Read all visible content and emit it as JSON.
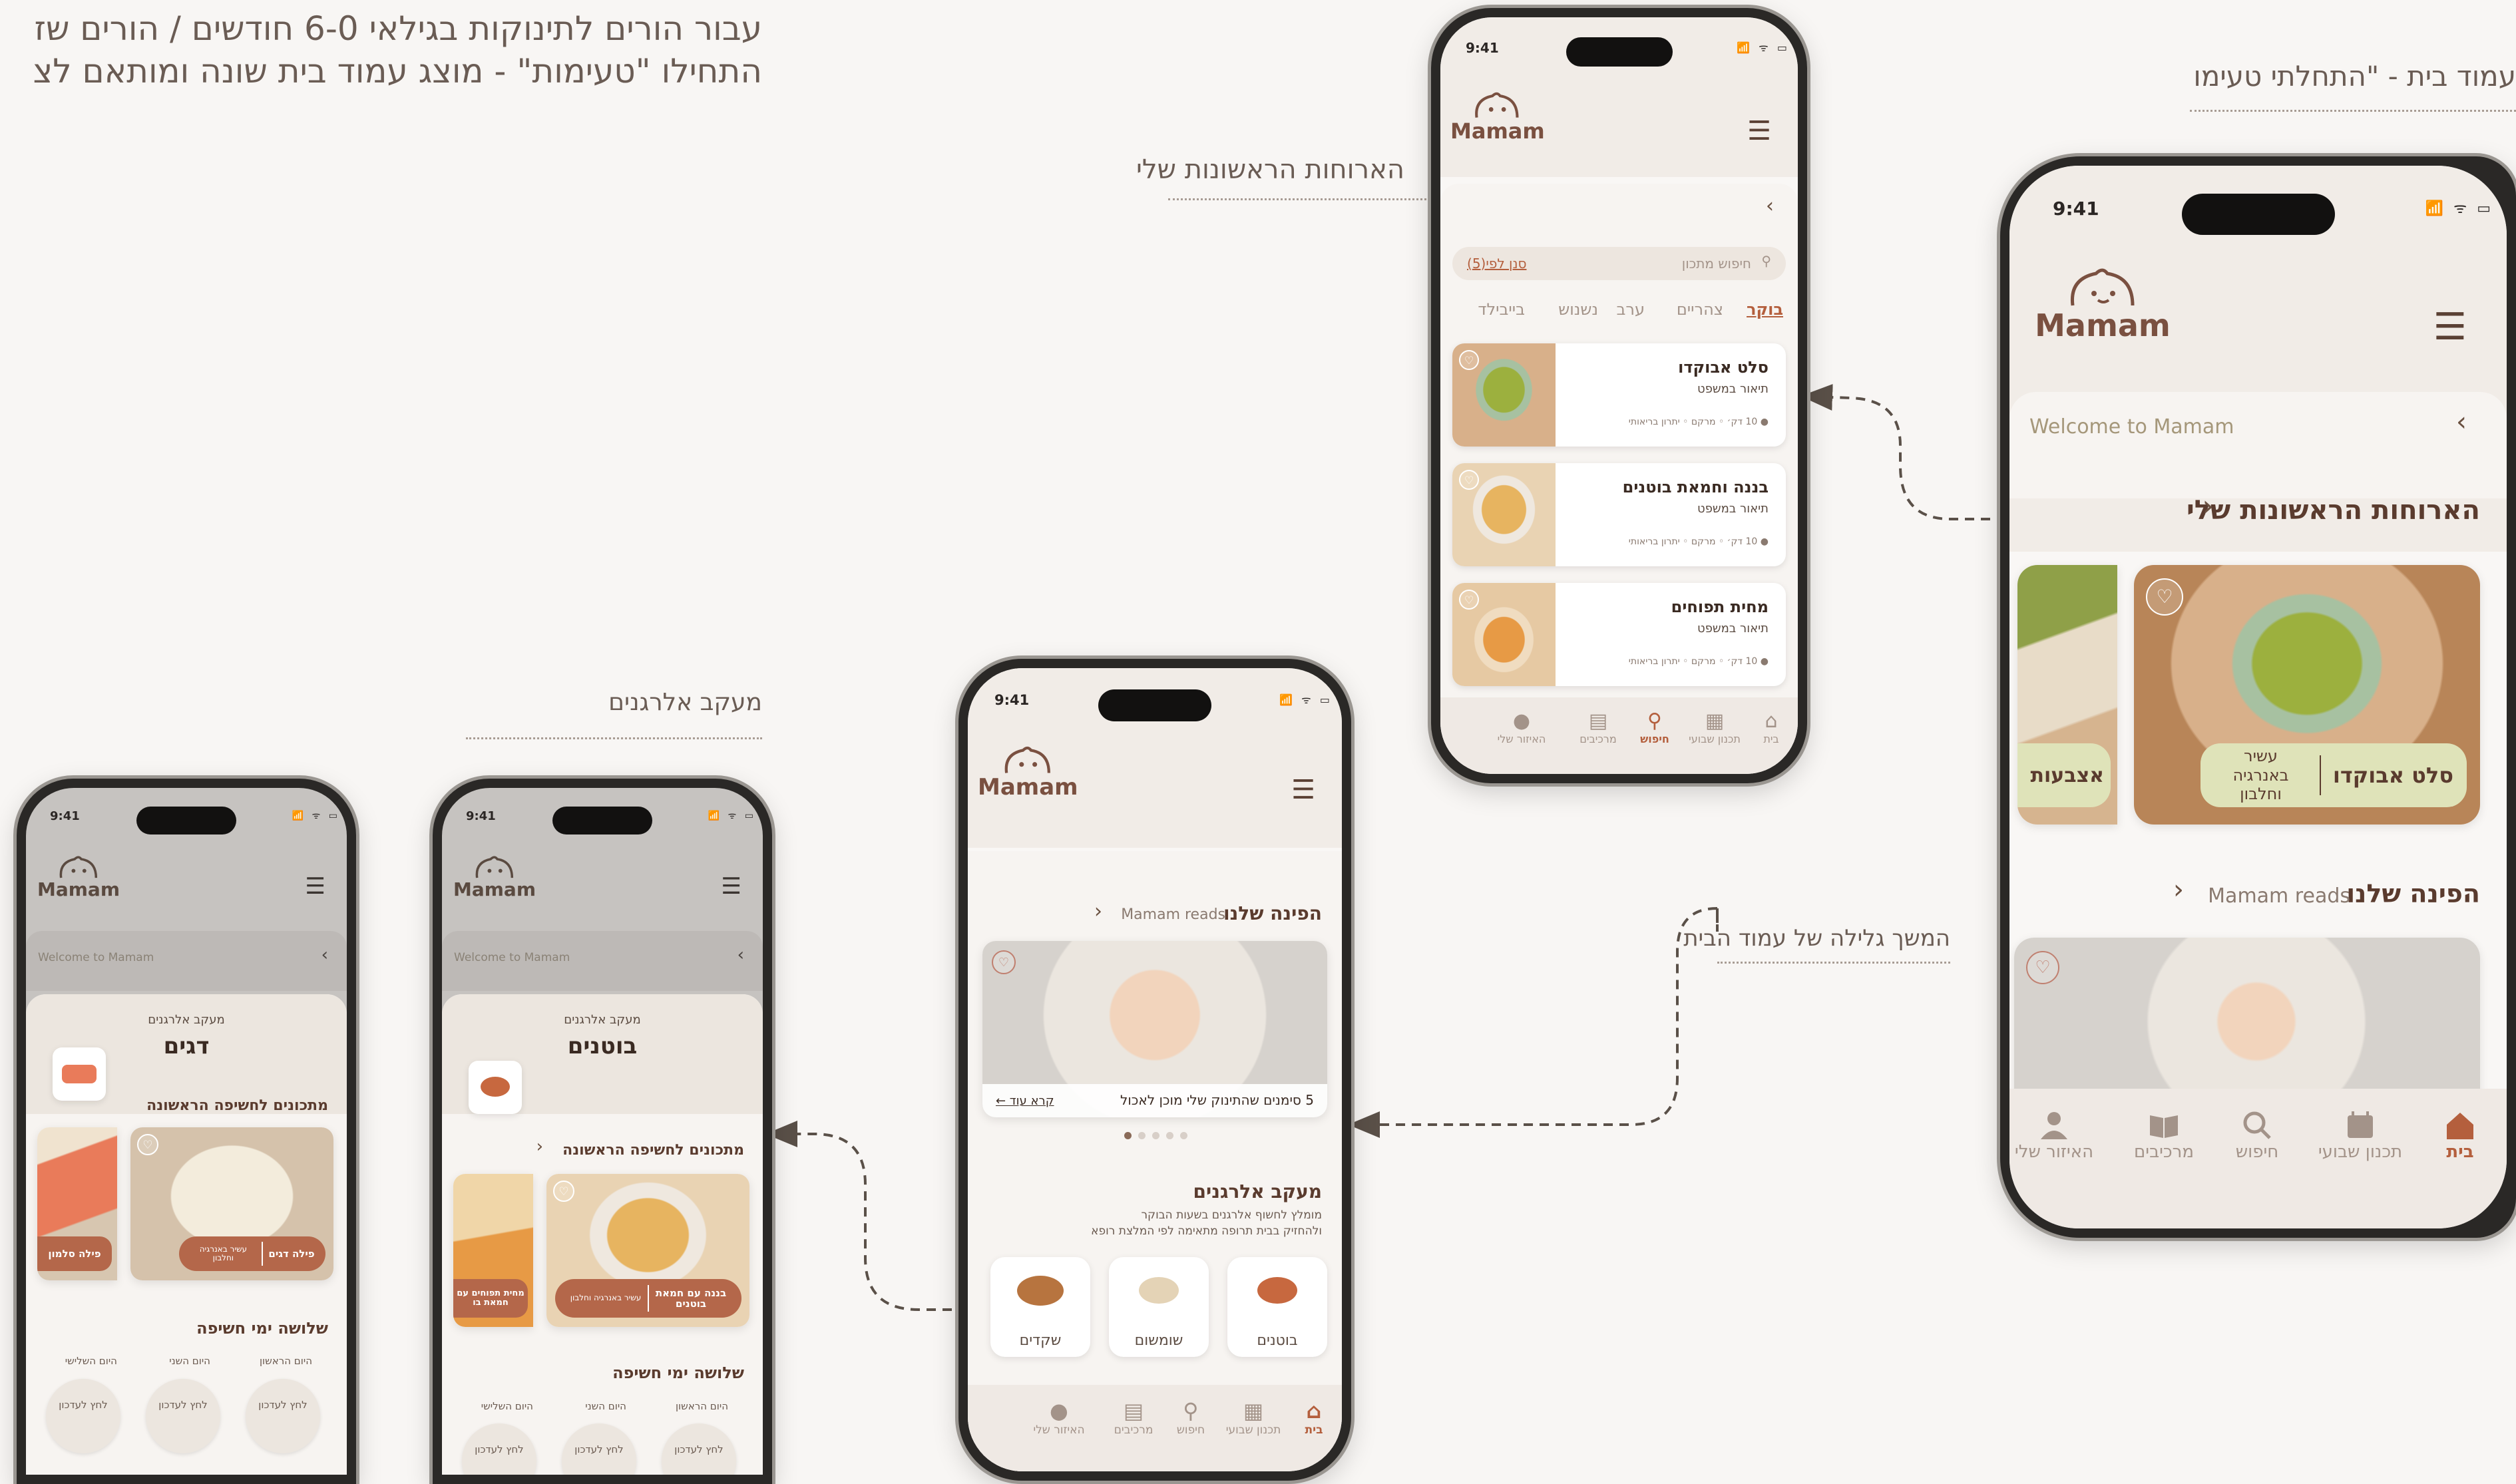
{
  "annotations": {
    "intro_line1": "עבור הורים לתינוקות בגילאי 6-0 חודשים / הורים שז",
    "intro_line2": "התחילו \"טעימות\" - מוצג עמוד בית שונה ומותאם לצ",
    "home_title": "עמוד בית - \"התחלתי טעימות\"",
    "my_meals_label": "הארוחות הראשונות שלי",
    "scroll_label": "המשך גלילה של עמוד הבית",
    "allergen_label": "מעקב אלרגנים"
  },
  "common": {
    "time": "9:41",
    "logo": "Mamam",
    "welcome": "Welcome to Mamam",
    "tabs": {
      "home": "בית",
      "weekly": "תכנון שבועי",
      "search": "חיפוש",
      "ingredients": "מרכיבים",
      "personal": "האיזור שלי"
    },
    "status_icons": "📶 ᯤ ▭"
  },
  "phone_home": {
    "section_meals": "הארוחות הראשונות שלי",
    "meal1_name": "סלט אבוקדו",
    "meal1_tag": "עשיר באנרגיה וחלבון",
    "meal2_name": "אצבעות",
    "section_corner": "הפינה שלנו",
    "mamam_reads": "Mamam reads"
  },
  "phone_meals": {
    "search_placeholder": "חיפוש מתכון",
    "filter": "סנן לפי(5)",
    "meal_tabs": [
      "בוקר",
      "צהריים",
      "ערב",
      "נשנוש",
      "בייבילד"
    ],
    "recipes": [
      {
        "name": "סלט אבוקדו",
        "desc": "תיאור במשפט",
        "meta": "● 10 דק׳ ◦ מרקם ◦ יתרון בריאותי"
      },
      {
        "name": "בננה וחמאת בוטנים",
        "desc": "תיאור במשפט",
        "meta": "● 10 דק׳ ◦ מרקם ◦ יתרון בריאותי"
      },
      {
        "name": "מחית תפוחים",
        "desc": "תיאור במשפט",
        "meta": "● 10 דק׳ ◦ מרקם ◦ יתרון בריאותי"
      }
    ]
  },
  "phone_scroll": {
    "section_corner": "הפינה שלנו",
    "mamam_reads": "Mamam reads",
    "article_title": "5 סימנים שהתינוק שלי מוכן לאכול",
    "read_more": "קרא עוד ←",
    "allergen_title": "מעקב אלרגנים",
    "allergen_desc1": "מומלץ לחשוף אלרגנים בשעות הבוקר",
    "allergen_desc2": "ולהחזיק בבית תרופה מתאימה לפי המלצת רופא",
    "chips": [
      "בוטנים",
      "שומשום",
      "שקדים"
    ]
  },
  "phone_peanut": {
    "tracker": "מעקב אלרגנים",
    "allergen": "בוטנים",
    "first_recipes": "מתכונים לחשיפה הראשונה",
    "recipe1_name": "בננה עם חמאת בוטנים",
    "recipe1_tag": "עשיר באנרגיה וחלבון",
    "recipe2_name": "מחית תפוחים עם חמאת בו",
    "three_days": "שלושה ימי חשיפה",
    "days": [
      "היום הראשון",
      "היום השני",
      "היום השלישי"
    ],
    "day_btn": "לחץ לעדכון"
  },
  "phone_fish": {
    "tracker": "מעקב אלרגנים",
    "allergen": "דגים",
    "first_recipes": "מתכונים לחשיפה הראשונה",
    "recipe1_name": "פילה דגים",
    "recipe1_tag": "עשיר באנרגיה וחלבון",
    "recipe2_name": "פילה סלמון",
    "three_days": "שלושה ימי חשיפה",
    "days": [
      "היום הראשון",
      "היום השני",
      "היום השלישי"
    ],
    "day_btn": "לחץ לעדכון"
  },
  "colors": {
    "accent": "#b45f3d",
    "brand_brown": "#7a5040",
    "pill_green": "#dfe3b9",
    "background": "#f8f6f4"
  }
}
